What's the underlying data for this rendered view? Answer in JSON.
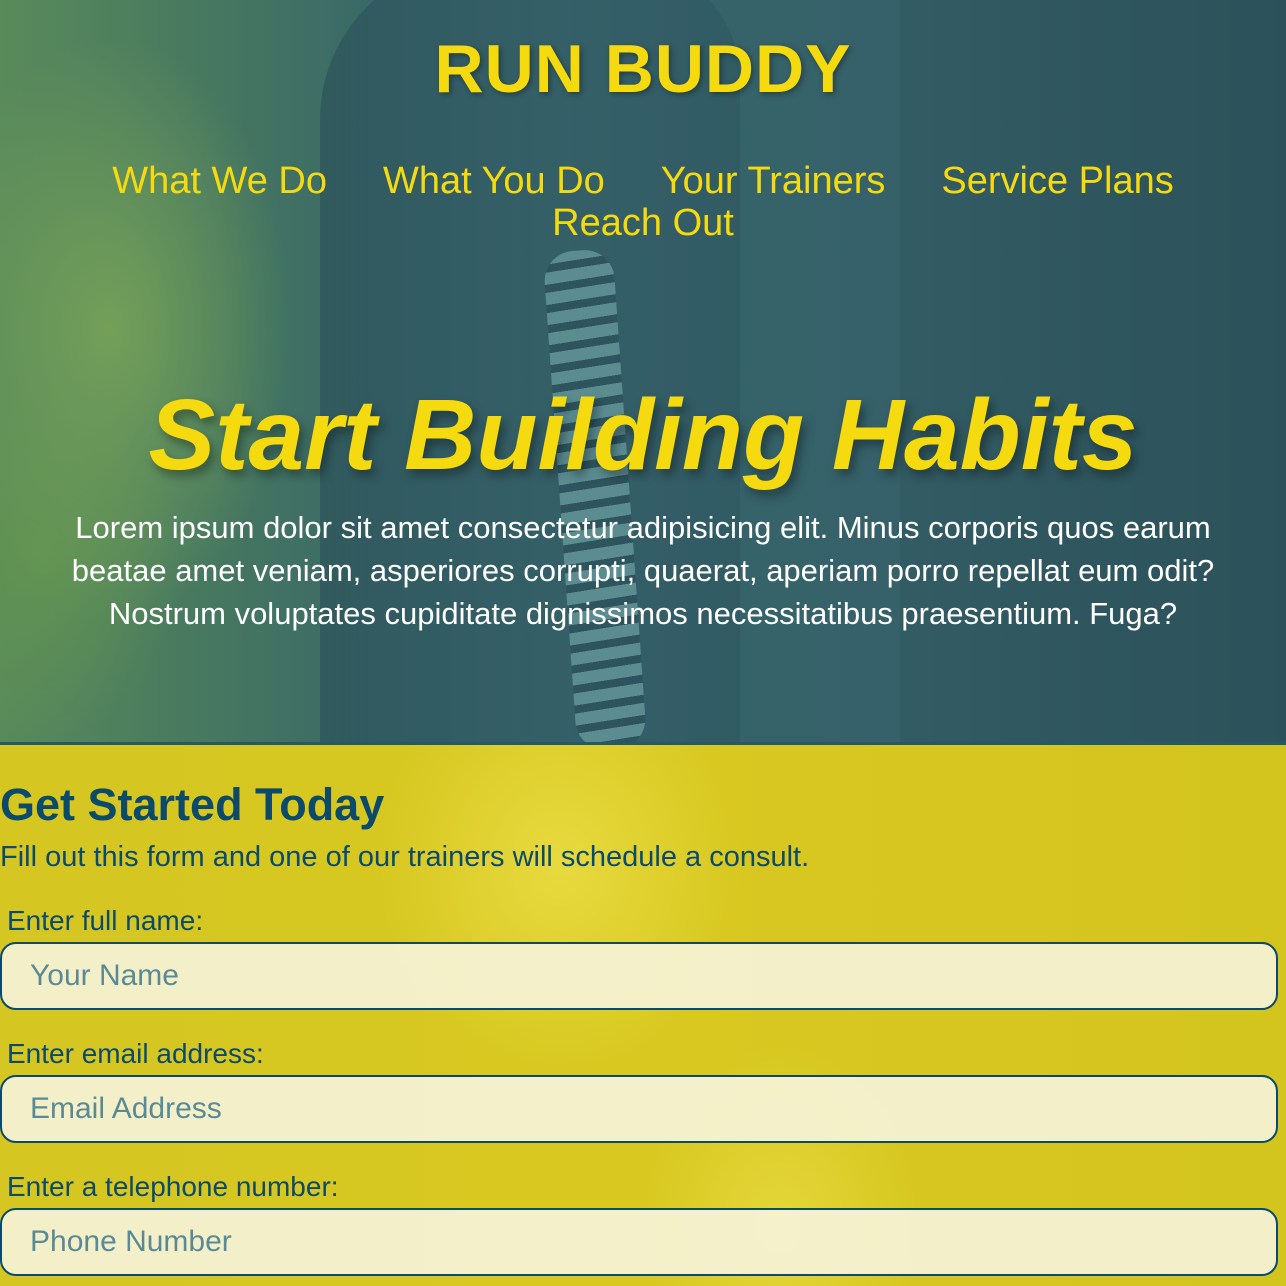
{
  "header": {
    "site_title": "RUN BUDDY",
    "nav": [
      {
        "label": "What We Do"
      },
      {
        "label": "What You Do"
      },
      {
        "label": "Your Trainers"
      },
      {
        "label": "Service Plans"
      },
      {
        "label": "Reach Out"
      }
    ]
  },
  "hero": {
    "heading": "Start Building Habits",
    "lines": [
      "Lorem ipsum dolor sit amet consectetur adipisicing elit. Minus corporis quos earum",
      "beatae amet veniam, asperiores corrupti, quaerat, aperiam porro repellat eum odit?",
      "Nostrum voluptates cupiditate dignissimos necessitatibus praesentium. Fuga?"
    ]
  },
  "signup": {
    "title": "Get Started Today",
    "description": "Fill out this form and one of our trainers will schedule a consult.",
    "fields": [
      {
        "label": "Enter full name:",
        "placeholder": "Your Name"
      },
      {
        "label": "Enter email address:",
        "placeholder": "Email Address"
      },
      {
        "label": "Enter a telephone number:",
        "placeholder": "Phone Number"
      }
    ]
  },
  "colors": {
    "accent_yellow": "#f5da0f",
    "dark_blue": "#0b4a6b",
    "form_background": "#d6c622"
  }
}
